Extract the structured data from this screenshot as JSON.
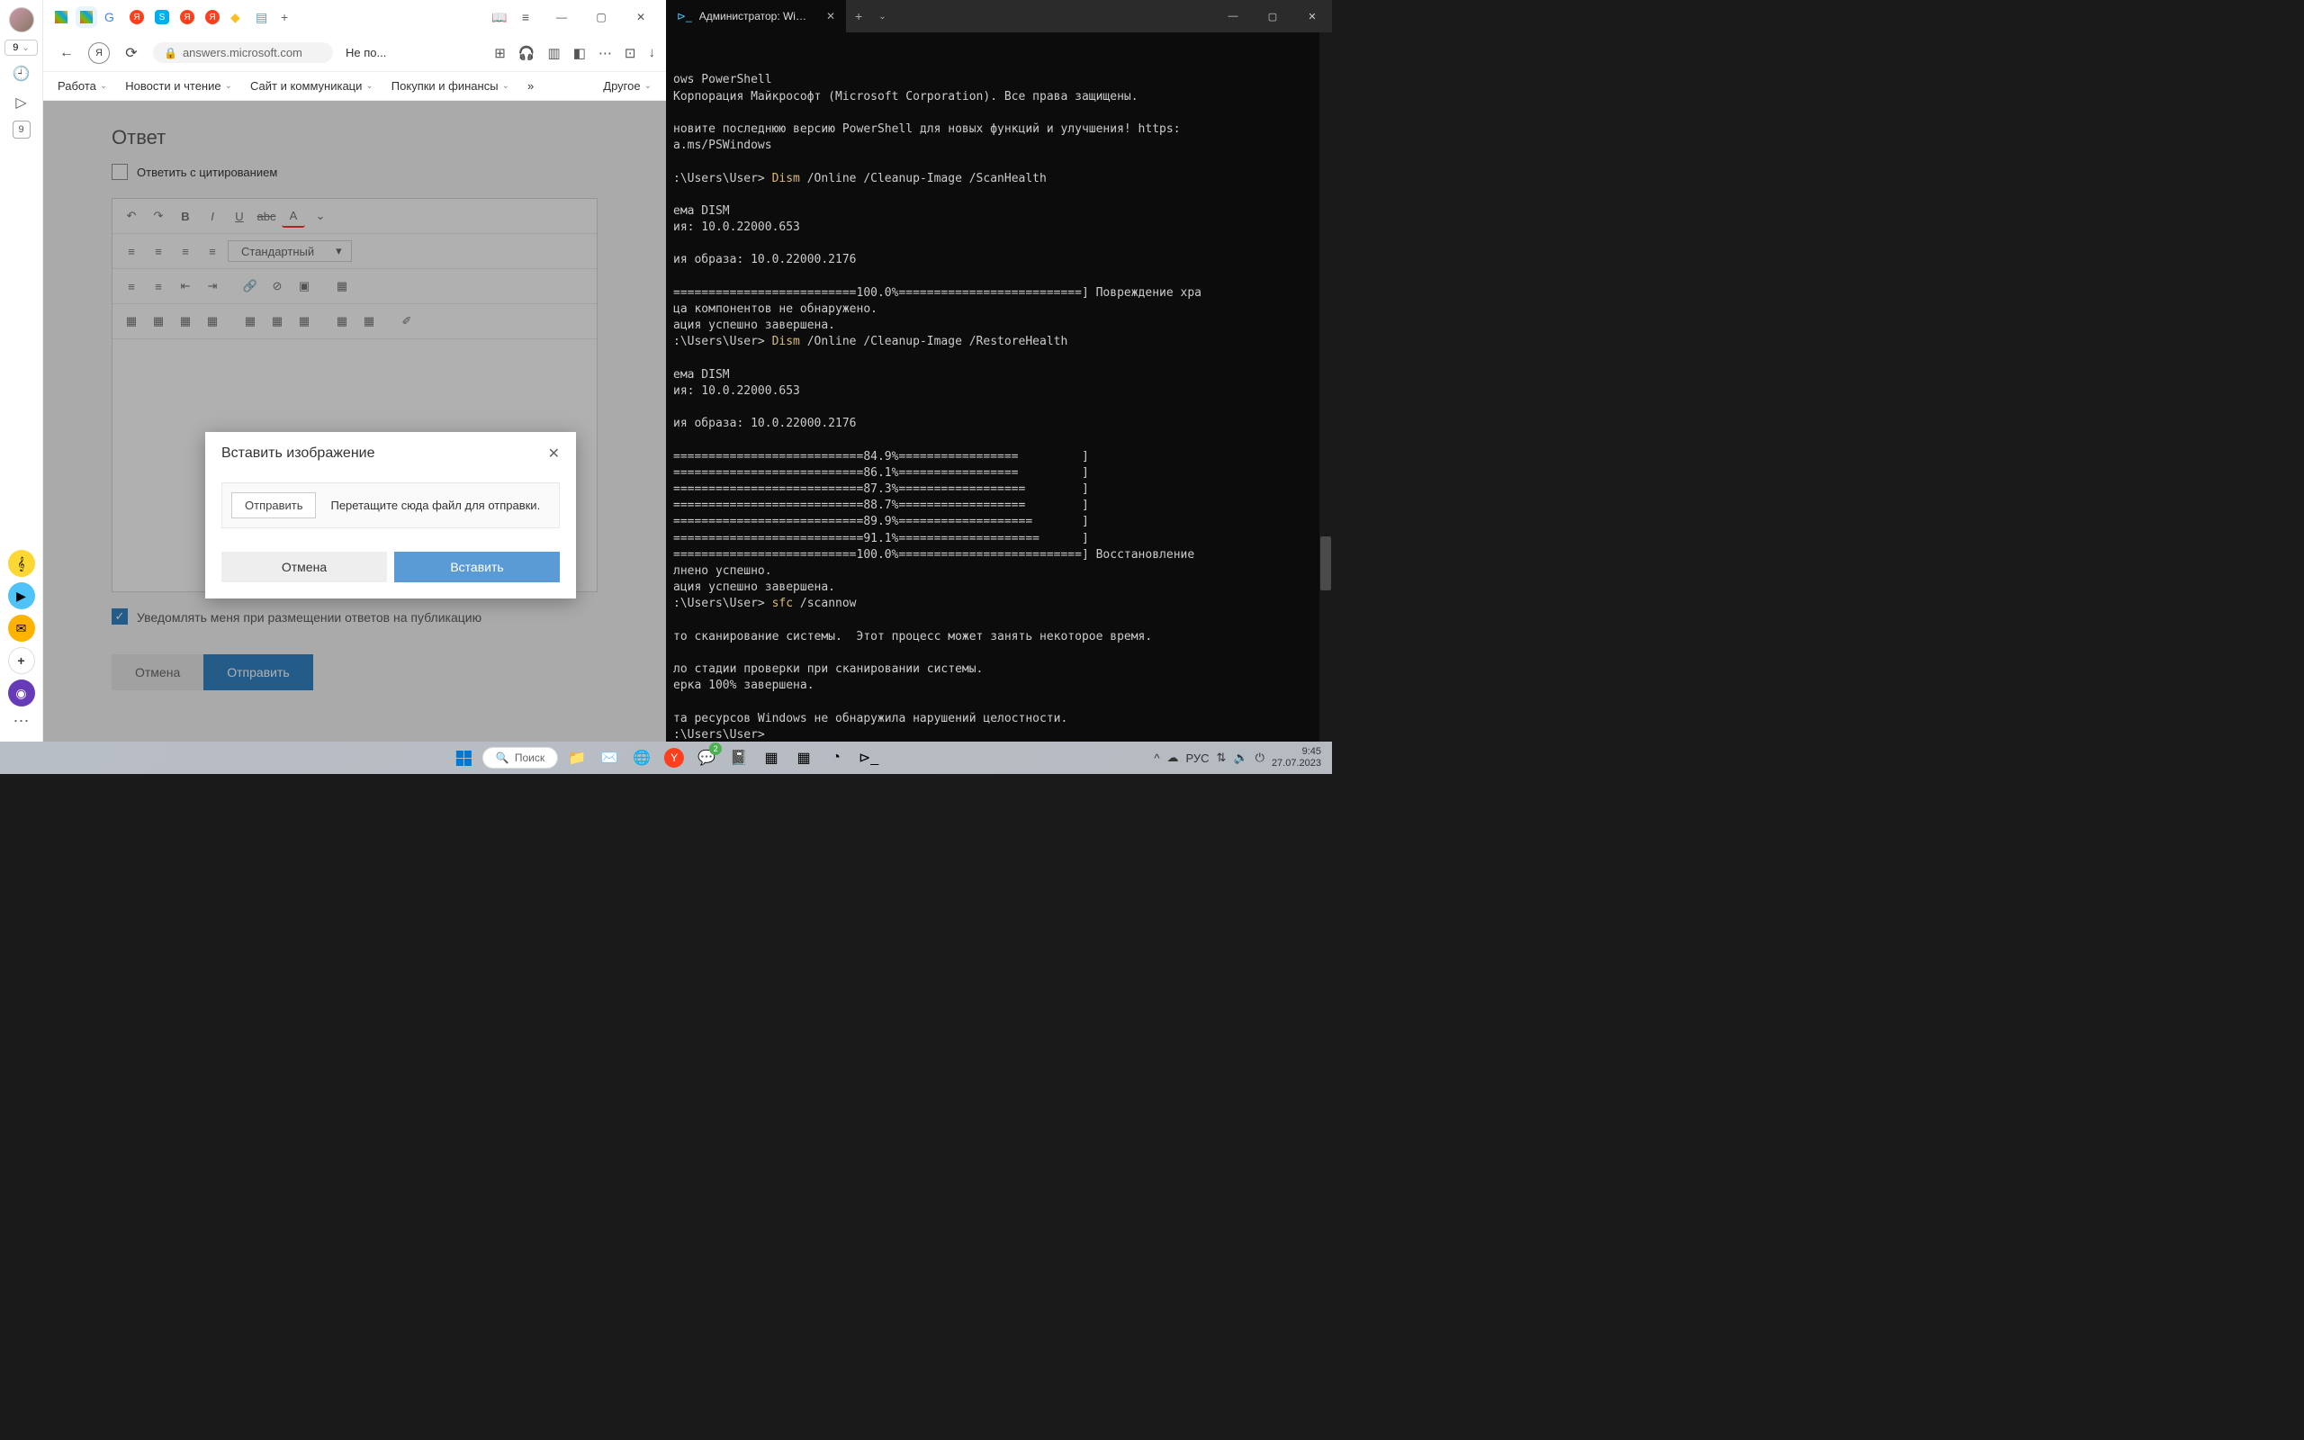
{
  "browser": {
    "sidebar": {
      "tab_count": "9"
    },
    "tabs": {
      "icons": [
        "ms",
        "ms-active",
        "g",
        "y",
        "s",
        "y2",
        "y3",
        "star",
        "doc"
      ],
      "plus": "+"
    },
    "titlebar": {
      "reader": "📖",
      "menu": "≡",
      "min": "—",
      "max": "▢",
      "close": "✕"
    },
    "address": {
      "url_host": "answers.microsoft.com",
      "page_title": "Не по..."
    },
    "bookmarks": {
      "items": [
        "Работа",
        "Новости и чтение",
        "Сайт и коммуникаци",
        "Покупки и финансы"
      ],
      "more": "»",
      "other": "Другое"
    },
    "page": {
      "answer_heading": "Ответ",
      "quote_label": "Ответить с цитированием",
      "toolbar": {
        "style_select": "Стандартный"
      },
      "notify_label": "Уведомлять меня при размещении ответов на публикацию",
      "btn_cancel": "Отмена",
      "btn_send": "Отправить"
    },
    "dialog": {
      "title": "Вставить изображение",
      "upload_btn": "Отправить",
      "hint": "Перетащите сюда файл для отправки.",
      "cancel": "Отмена",
      "insert": "Вставить"
    }
  },
  "terminal": {
    "tab_title": "Администратор: Windows Pc",
    "lines": [
      {
        "t": "ows PowerShell",
        "class": "c"
      },
      {
        "t": "Корпорация Майкрософт (Microsoft Corporation). Все права защищены.",
        "class": "c"
      },
      {
        "t": "",
        "class": "c"
      },
      {
        "t": "новите последнюю версию PowerShell для новых функций и улучшения! https:",
        "class": "c"
      },
      {
        "t": "a.ms/PSWindows",
        "class": "c"
      },
      {
        "t": "",
        "class": "c"
      },
      {
        "t": ":\\Users\\User> Dism /Online /Cleanup-Image /ScanHealth",
        "class": "mix",
        "pre": ":\\Users\\User> ",
        "cmd": "Dism",
        "rest": " /Online /Cleanup-Image /ScanHealth"
      },
      {
        "t": "",
        "class": "c"
      },
      {
        "t": "ема DISM",
        "class": "c"
      },
      {
        "t": "ия: 10.0.22000.653",
        "class": "c"
      },
      {
        "t": "",
        "class": "c"
      },
      {
        "t": "ия образа: 10.0.22000.2176",
        "class": "c"
      },
      {
        "t": "",
        "class": "c"
      },
      {
        "t": "==========================100.0%==========================] Повреждение хра",
        "class": "c"
      },
      {
        "t": "ца компонентов не обнаружено.",
        "class": "c"
      },
      {
        "t": "ация успешно завершена.",
        "class": "c"
      },
      {
        "t": ":\\Users\\User> Dism /Online /Cleanup-Image /RestoreHealth",
        "class": "mix",
        "pre": ":\\Users\\User> ",
        "cmd": "Dism",
        "rest": " /Online /Cleanup-Image /RestoreHealth"
      },
      {
        "t": "",
        "class": "c"
      },
      {
        "t": "ема DISM",
        "class": "c"
      },
      {
        "t": "ия: 10.0.22000.653",
        "class": "c"
      },
      {
        "t": "",
        "class": "c"
      },
      {
        "t": "ия образа: 10.0.22000.2176",
        "class": "c"
      },
      {
        "t": "",
        "class": "c"
      },
      {
        "t": "===========================84.9%=================         ]",
        "class": "c"
      },
      {
        "t": "===========================86.1%=================         ]",
        "class": "c"
      },
      {
        "t": "===========================87.3%==================        ]",
        "class": "c"
      },
      {
        "t": "===========================88.7%==================        ]",
        "class": "c"
      },
      {
        "t": "===========================89.9%===================       ]",
        "class": "c"
      },
      {
        "t": "===========================91.1%====================      ]",
        "class": "c"
      },
      {
        "t": "==========================100.0%==========================] Восстановление",
        "class": "c"
      },
      {
        "t": "лнено успешно.",
        "class": "c"
      },
      {
        "t": "ация успешно завершена.",
        "class": "c"
      },
      {
        "t": ":\\Users\\User> sfc /scannow",
        "class": "mix",
        "pre": ":\\Users\\User> ",
        "cmd": "sfc",
        "rest": " /scannow"
      },
      {
        "t": "",
        "class": "c"
      },
      {
        "t": "то сканирование системы.  Этот процесс может занять некоторое время.",
        "class": "c"
      },
      {
        "t": "",
        "class": "c"
      },
      {
        "t": "ло стадии проверки при сканировании системы.",
        "class": "c"
      },
      {
        "t": "ерка 100% завершена.",
        "class": "c"
      },
      {
        "t": "",
        "class": "c"
      },
      {
        "t": "та ресурсов Windows не обнаружила нарушений целостности.",
        "class": "c"
      },
      {
        "t": ":\\Users\\User>",
        "class": "c"
      }
    ]
  },
  "taskbar": {
    "search": "Поиск",
    "time": "9:45",
    "date": "27.07.2023",
    "lang": "РУС"
  }
}
